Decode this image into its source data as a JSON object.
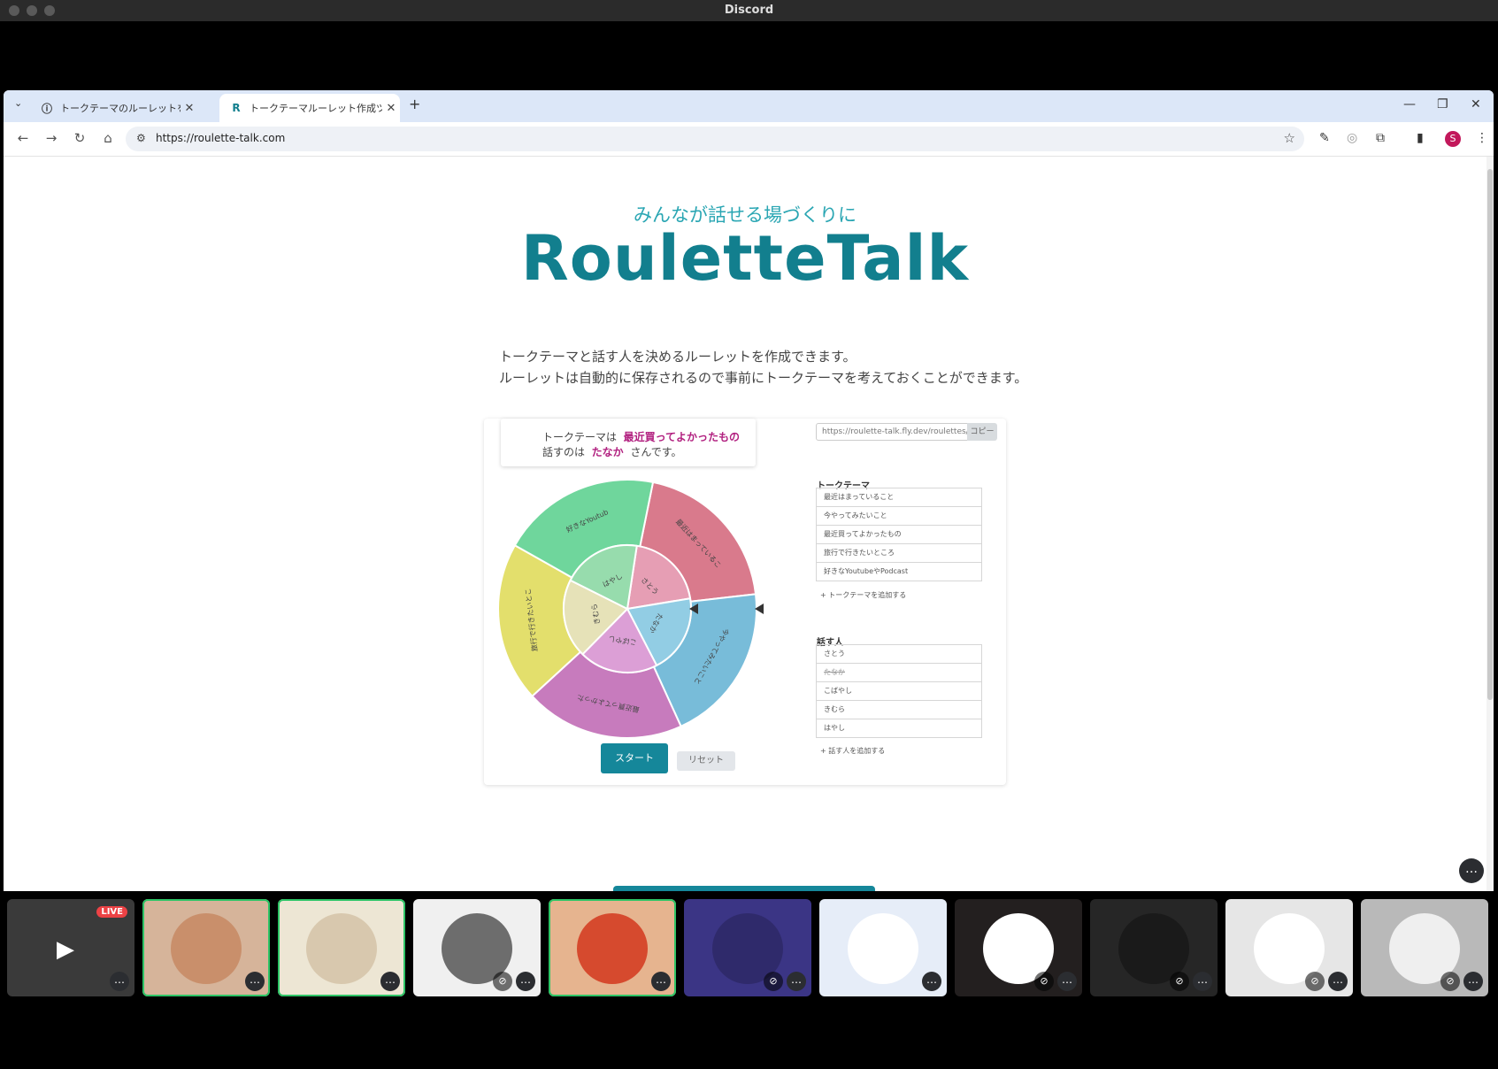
{
  "window": {
    "title": "Discord"
  },
  "browser": {
    "tabs": [
      {
        "label": "トークテーマのルーレットを作成できるツール",
        "favicon": "info-icon",
        "active": false
      },
      {
        "label": "トークテーマルーレット作成ツール | RouletteTalk",
        "favicon": "R",
        "active": true
      }
    ],
    "url": "https://roulette-talk.com"
  },
  "page": {
    "tagline": "みんなが話せる場づくりに",
    "logo": "RouletteTalk",
    "desc_line1": "トークテーマと話す人を決めるルーレットを作成できます。",
    "desc_line2": "ルーレットは自動的に保存されるので事前にトークテーマを考えておくことができます。",
    "result": {
      "theme_prefix": "トークテーマは",
      "theme_value": "最近買ってよかったもの",
      "speaker_prefix": "話すのは",
      "speaker_value": "たなか",
      "speaker_suffix": "さんです。"
    },
    "wheel": {
      "outer": [
        {
          "label": "最近はまっていること",
          "color": "#d97a8c"
        },
        {
          "label": "今やってみたいこと",
          "color": "#78bcd9"
        },
        {
          "label": "最近買ってよかったもの",
          "color": "#c77bbd"
        },
        {
          "label": "旅行で行きたいところ",
          "color": "#e3df6c"
        },
        {
          "label": "好きなYoutube…",
          "color": "#6fd69c"
        }
      ],
      "inner": [
        {
          "label": "さとう",
          "color": "#e69eb4"
        },
        {
          "label": "たなか",
          "color": "#92cde4"
        },
        {
          "label": "こばやし",
          "color": "#dc9fd6"
        },
        {
          "label": "きむら",
          "color": "#e6e2b8"
        },
        {
          "label": "はやし",
          "color": "#97dcad"
        }
      ]
    },
    "start_label": "スタート",
    "reset_label": "リセット",
    "share_url": "https://roulette-talk.fly.dev/roulettes/xxxx",
    "copy_label": "コピー",
    "themes_title": "トークテーマ",
    "themes": [
      "最近はまっていること",
      "今やってみたいこと",
      "最近買ってよかったもの",
      "旅行で行きたいところ",
      "好きなYoutubeやPodcast"
    ],
    "add_theme_label": "+ トークテーマを追加する",
    "speakers_title": "話す人",
    "speakers": [
      "さとう",
      "たなか",
      "こばやし",
      "きむら",
      "はやし"
    ],
    "add_speaker_label": "+ 話す人を追加する"
  },
  "participants": [
    {
      "name": "screen-share",
      "live": "LIVE",
      "bg": "#3a3a3a"
    },
    {
      "name": "guitar-avatar",
      "bg": "#d6b49a",
      "av": "#c98f6b",
      "speaking": true
    },
    {
      "name": "shiba-avatar",
      "bg": "#ede6d4",
      "av": "#d8c8ae",
      "speaking": true
    },
    {
      "name": "person-avatar",
      "bg": "#f0f0f0",
      "av": "#6d6d6d",
      "muted": true
    },
    {
      "name": "glasses-avatar",
      "bg": "#e6b48f",
      "av": "#d64a2e",
      "speaking": true
    },
    {
      "name": "deer-avatar",
      "bg": "#3b3585",
      "av": "#2f2a6b",
      "muted": true
    },
    {
      "name": "sketch-avatar",
      "bg": "#e6edf8",
      "av": "#ffffff"
    },
    {
      "name": "kanji-avatar",
      "bg": "#231f1f",
      "av": "#ffffff",
      "muted": true
    },
    {
      "name": "sunglasses-avatar",
      "bg": "#262626",
      "av": "#1a1a1a",
      "muted": true
    },
    {
      "name": "pot-avatar",
      "bg": "#e6e6e6",
      "av": "#ffffff",
      "muted": true
    },
    {
      "name": "cat-avatar",
      "bg": "#b9b9b9",
      "av": "#efefef",
      "muted": true
    }
  ]
}
